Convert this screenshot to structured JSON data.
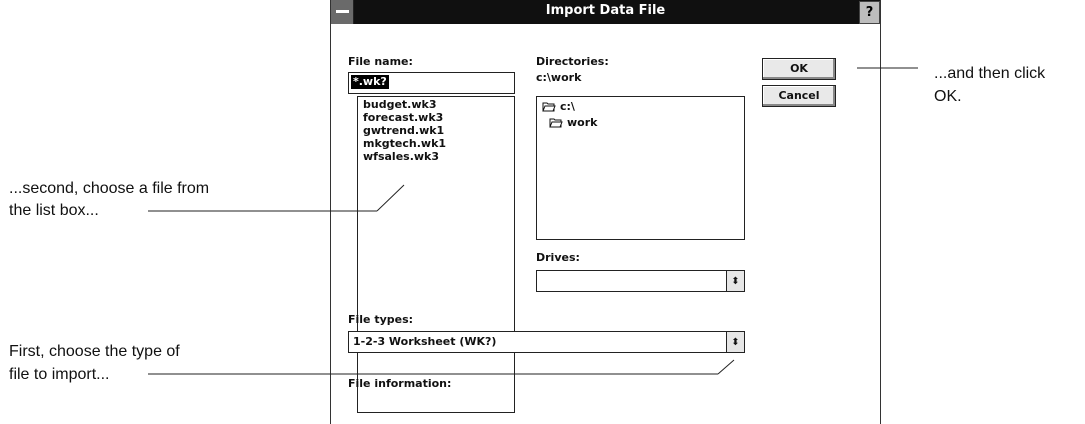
{
  "dialog": {
    "title": "Import Data File",
    "help_label": "?",
    "file_name_label": "File name:",
    "file_name_value": "*.wk?",
    "files": [
      "budget.wk3",
      "forecast.wk3",
      "gwtrend.wk1",
      "mkgtech.wk1",
      "wfsales.wk3"
    ],
    "directories_label": "Directories:",
    "current_directory": "c:\\work",
    "directory_items": [
      "c:\\",
      "work"
    ],
    "drives_label": "Drives:",
    "drives_value": "",
    "file_types_label": "File types:",
    "file_types_value": "1-2-3 Worksheet (WK?)",
    "file_information_label": "File information:",
    "ok_label": "OK",
    "cancel_label": "Cancel",
    "dropdown_arrow": "⬍"
  },
  "callouts": {
    "ok_line1": "...and then click",
    "ok_line2": "OK.",
    "list_line1": "...second, choose a file from",
    "list_line2": "the list box...",
    "type_line1": "First, choose the type of",
    "type_line2": "file to import..."
  }
}
